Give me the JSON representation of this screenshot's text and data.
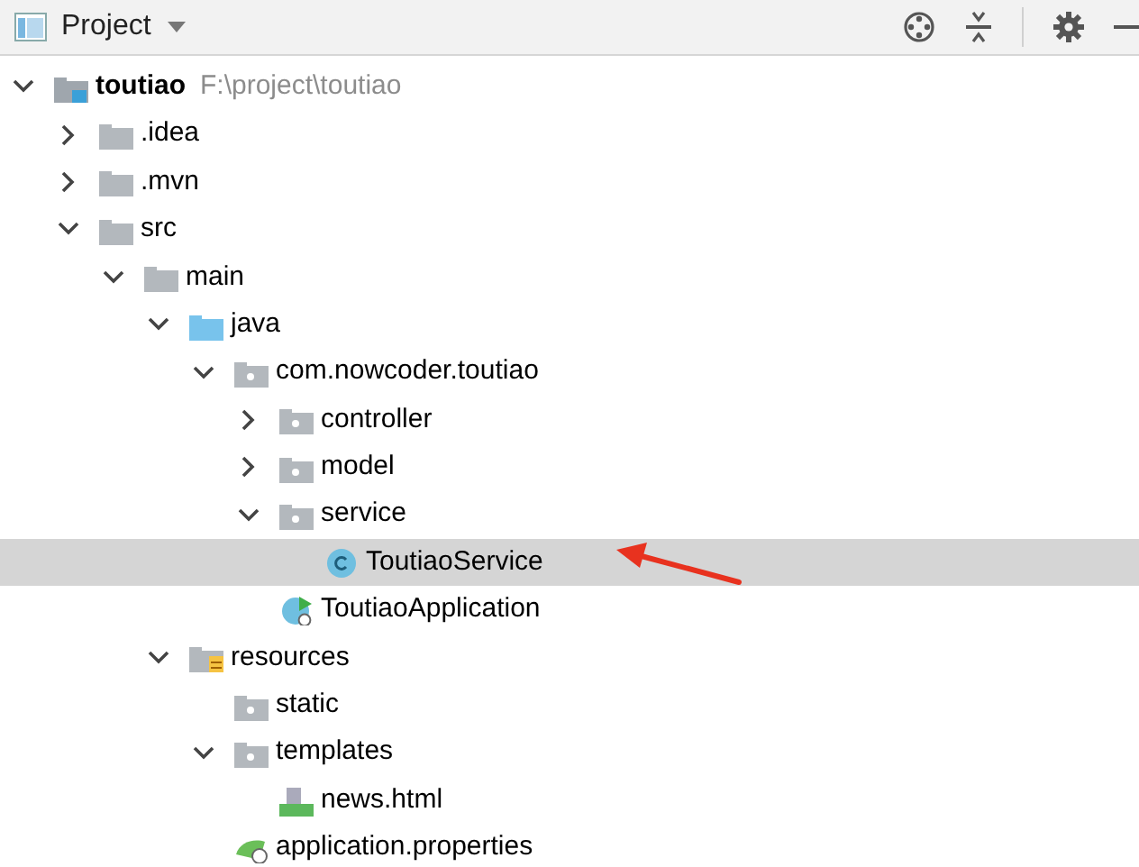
{
  "panel": {
    "title": "Project"
  },
  "tree": [
    {
      "kind": "module",
      "label": "toutiao",
      "path": "F:\\project\\toutiao",
      "expanded": true,
      "selected": false,
      "children": [
        {
          "kind": "folder",
          "label": ".idea",
          "expanded": false,
          "selected": false
        },
        {
          "kind": "folder",
          "label": ".mvn",
          "expanded": false,
          "selected": false
        },
        {
          "kind": "folder",
          "label": "src",
          "expanded": true,
          "selected": false,
          "children": [
            {
              "kind": "folder",
              "label": "main",
              "expanded": true,
              "selected": false,
              "children": [
                {
                  "kind": "source-folder",
                  "label": "java",
                  "expanded": true,
                  "selected": false,
                  "children": [
                    {
                      "kind": "package",
                      "label": "com.nowcoder.toutiao",
                      "expanded": true,
                      "selected": false,
                      "children": [
                        {
                          "kind": "package",
                          "label": "controller",
                          "expanded": false,
                          "selected": false
                        },
                        {
                          "kind": "package",
                          "label": "model",
                          "expanded": false,
                          "selected": false
                        },
                        {
                          "kind": "package",
                          "label": "service",
                          "expanded": true,
                          "selected": false,
                          "children": [
                            {
                              "kind": "class",
                              "label": "ToutiaoService",
                              "selected": true
                            }
                          ]
                        },
                        {
                          "kind": "app-class",
                          "label": "ToutiaoApplication",
                          "selected": false
                        }
                      ]
                    }
                  ]
                },
                {
                  "kind": "resources-folder",
                  "label": "resources",
                  "expanded": true,
                  "selected": false,
                  "children": [
                    {
                      "kind": "package",
                      "label": "static",
                      "selected": false
                    },
                    {
                      "kind": "package",
                      "label": "templates",
                      "expanded": true,
                      "selected": false,
                      "children": [
                        {
                          "kind": "html",
                          "label": "news.html",
                          "selected": false
                        }
                      ]
                    },
                    {
                      "kind": "properties",
                      "label": "application.properties",
                      "selected": false
                    }
                  ]
                }
              ]
            }
          ]
        }
      ]
    }
  ]
}
